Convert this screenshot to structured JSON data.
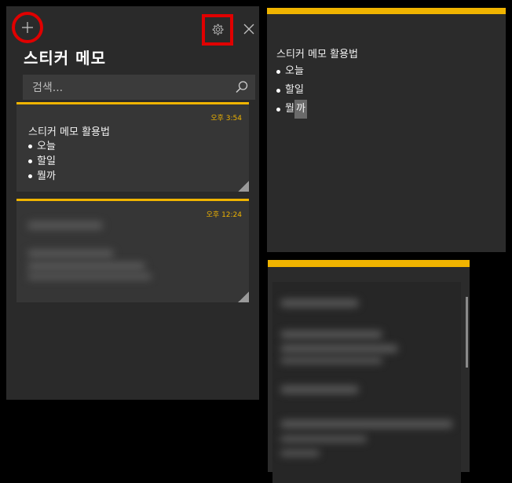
{
  "list_panel": {
    "title": "스티커 메모",
    "search": {
      "placeholder": "검색..."
    },
    "notes": [
      {
        "time_prefix": "오후",
        "time": "3:54",
        "title": "스티커 메모 활용법",
        "items": [
          "오늘",
          "할일",
          "뭘까"
        ]
      },
      {
        "time_prefix": "오후",
        "time": "12:24"
      }
    ]
  },
  "open_note_1": {
    "title": "스티커 메모 활용법",
    "items": [
      "오늘",
      "할일"
    ],
    "last_item_plain": "뭘",
    "last_item_selected": "까"
  },
  "colors": {
    "accent_yellow": "#f0b400",
    "highlight_red": "#e00000",
    "panel_bg": "#2a2a2a",
    "card_bg": "#363636"
  },
  "icons": [
    "plus-icon",
    "gear-icon",
    "close-icon",
    "search-icon"
  ]
}
